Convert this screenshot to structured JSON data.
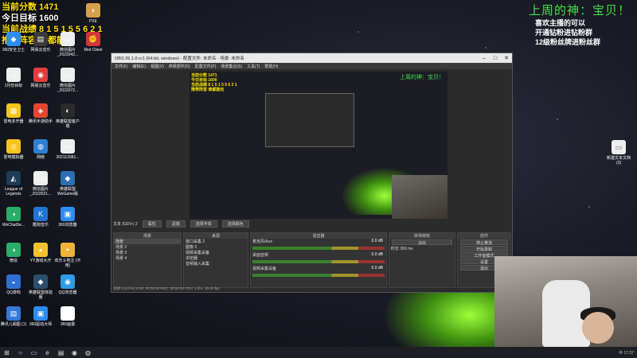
{
  "overlay": {
    "score": "当前分数 1471",
    "goal": "今日目标 1600",
    "record": "当前战绩 8 1 5 1 5 5 6 2 1",
    "recommend": "推荐阵容 谁都能玩",
    "god_title": "上周的神：宝贝！",
    "line1": "喜欢主播的可以",
    "line2": "开通钻粉进钻粉群",
    "line3": "12级粉丝牌进粉丝群"
  },
  "desktop": {
    "icons": [
      {
        "label": "360安全卫士",
        "color": "#2d8cf0",
        "glyph": "◆"
      },
      {
        "label": "网易云音乐",
        "color": "#3a3a3a",
        "glyph": "▤"
      },
      {
        "label": "微信图片_2022042...",
        "color": "#eeeeee",
        "glyph": "▭"
      },
      {
        "label": "Riot Client",
        "color": "#d13639",
        "glyph": "✊"
      },
      {
        "label": "PXE",
        "color": "#d6a14b",
        "glyph": "◗"
      },
      {
        "label": "1月份目标",
        "color": "#eeeeee",
        "glyph": "▭"
      },
      {
        "label": "网易云音乐",
        "color": "#e23d3d",
        "glyph": "◉"
      },
      {
        "label": "微信图片_2022072...",
        "color": "#eeeeee",
        "glyph": "▭"
      },
      {
        "label": "雷电多开器",
        "color": "#f5c518",
        "glyph": "▦"
      },
      {
        "label": "腾讯手游助手",
        "color": "#e6452f",
        "glyph": "◈"
      },
      {
        "label": "英雄联盟客户端",
        "color": "#2b2b2b",
        "glyph": "◐"
      },
      {
        "label": "雷电模拟器",
        "color": "#f5c518",
        "glyph": "◎"
      },
      {
        "label": "网络",
        "color": "#2d7fd3",
        "glyph": "◍"
      },
      {
        "label": "202112081...",
        "color": "#eeeeee",
        "glyph": "▭"
      },
      {
        "label": "League of Legends",
        "color": "#1d3c57",
        "glyph": "◭"
      },
      {
        "label": "微信图片_2022021...",
        "color": "#eeeeee",
        "glyph": "▭"
      },
      {
        "label": "英雄联盟 WeGame版",
        "color": "#2c6fb3",
        "glyph": "◆"
      },
      {
        "label": "WeChatSe...",
        "color": "#2aae67",
        "glyph": "◑"
      },
      {
        "label": "酷狗音乐",
        "color": "#1f74d4",
        "glyph": "K"
      },
      {
        "label": "360浏览器",
        "color": "#2d8cf0",
        "glyph": "▣"
      },
      {
        "label": "微信",
        "color": "#2aae67",
        "glyph": "◑"
      },
      {
        "label": "YY游戏大厅",
        "color": "#f3c12b",
        "glyph": "◕"
      },
      {
        "label": "欢乐斗地主 (不用)",
        "color": "#f0b23a",
        "glyph": "◓"
      },
      {
        "label": "QQ游戏",
        "color": "#2f6fd1",
        "glyph": "◒"
      },
      {
        "label": "英雄联盟体验服",
        "color": "#2a4f6e",
        "glyph": "◆"
      },
      {
        "label": "QQ浏览器",
        "color": "#2e9be8",
        "glyph": "◉"
      },
      {
        "label": "腾讯儿阁图 (1)",
        "color": "#3478d8",
        "glyph": "▤"
      },
      {
        "label": "360驱动大师",
        "color": "#2d8cf0",
        "glyph": "▣"
      },
      {
        "label": "360画报",
        "color": "#ffffff",
        "glyph": "▣"
      }
    ],
    "right_icon": {
      "label": "新建文本文档 (3)",
      "glyph": "▭"
    }
  },
  "obs": {
    "title": "OBS 26.1.0-rc1 (64-bit, windows) - 配置文件: 未命名 - 场景: 未命名",
    "menu": [
      "文件(F)",
      "编辑(E)",
      "视图(V)",
      "停靠部件(D)",
      "配置文件(P)",
      "场景集合(S)",
      "工具(T)",
      "帮助(H)"
    ],
    "source_label": "文本 (GDI+) 2",
    "source_buttons": [
      "属性",
      "滤镜",
      "选择字体",
      "选择颜色"
    ],
    "scenes_title": "场景",
    "scenes": [
      "场景",
      "场景 2",
      "场景 3",
      "场景 4"
    ],
    "sources_title": "来源",
    "sources": [
      "窗口采集 2",
      "图像 5",
      "视频采集设备",
      "浏览器",
      "音频输入采集"
    ],
    "mixer_title": "混音器",
    "mixer": [
      {
        "name": "麦克风/Aux",
        "db": "0.0 dB"
      },
      {
        "name": "桌面音频",
        "db": "0.0 dB"
      },
      {
        "name": "视频采集设备",
        "db": "0.0 dB"
      }
    ],
    "transitions_title": "转场特效",
    "transition_value": "淡出",
    "duration_label": "时长",
    "duration_value": "300 ms",
    "controls_title": "控件",
    "controls": [
      "停止推流",
      "开始录制",
      "工作室模式",
      "设置",
      "退出"
    ],
    "status": "丢帧 0 (0.0%)  LIVE: 00:00:00  REC: 00:00:00  CPU: 1.0%, 30.00 fps"
  },
  "taskbar": {
    "time": "17:37",
    "lang": "中"
  }
}
